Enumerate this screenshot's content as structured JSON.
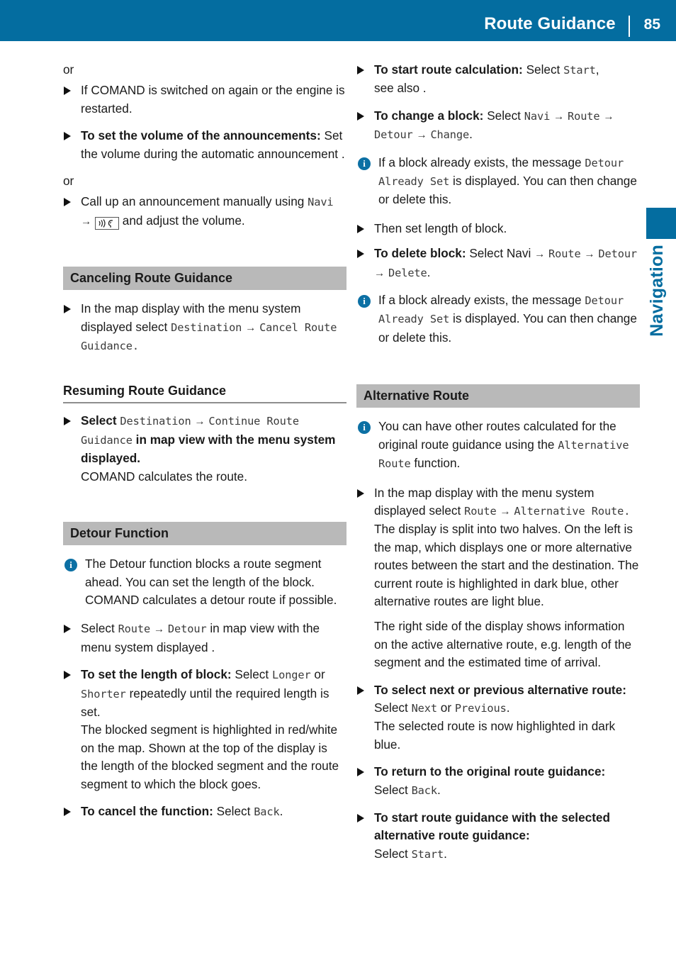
{
  "header": {
    "title": "Route Guidance",
    "page_number": "85",
    "accent_color": "#046da0"
  },
  "side_tab": {
    "label": "Navigation",
    "color": "#046da0"
  },
  "icons": {
    "bullet": "triangle-right-icon",
    "info": "info-circle-icon",
    "sound": "sound-volume-ear-icon"
  },
  "left_column": {
    "or_1": "or",
    "item_comand_restart": "If COMAND is switched on again or the engine is restarted.",
    "item_volume_bold": "To set the volume of the announcements:",
    "item_volume_rest": "Set the volume during the automatic announcement .",
    "or_2": "or",
    "item_manual_pre": "Call up an announcement manually using",
    "item_manual_menu": "Navi",
    "item_manual_arrow": "→",
    "item_manual_post": "and adjust the volume.",
    "heading_canceling": "Canceling Route Guidance",
    "item_cancel_pre": "In the map display with the menu system displayed select",
    "item_cancel_menu_1": "Destination",
    "item_cancel_arrow": "→",
    "item_cancel_menu_2": "Cancel Route Guidance",
    "item_cancel_post": ".",
    "subheading_resuming": "Resuming Route Guidance",
    "item_resume_pre": "Select",
    "item_resume_menu_1": "Destination",
    "item_resume_arrow": "→",
    "item_resume_menu_2": "Continue Route Guidance",
    "item_resume_post": "in map view with the menu system displayed.",
    "item_resume_line2": "COMAND calculates the route.",
    "heading_detour": "Detour Function",
    "note_detour": "The Detour function blocks a route segment ahead. You can set the length of the block. COMAND calculates a detour route if possible.",
    "item_select_pre": "Select",
    "item_select_menu_1": "Route",
    "item_select_arrow": "→",
    "item_select_menu_2": "Detour",
    "item_select_post": "in map view with the menu system displayed .",
    "item_length_bold": "To set the length of block:",
    "item_length_select": "Select",
    "item_length_menu_1": "Longer",
    "item_length_or": "or",
    "item_length_menu_2": "Shorter",
    "item_length_rest": "repeatedly until the required length is set.",
    "item_length_line2": "The blocked segment is highlighted in red/white on the map. Shown at the top of the display is the length of the blocked segment and the route segment to which the block goes.",
    "item_cancelfn_bold": "To cancel the function:",
    "item_cancelfn_select": "Select",
    "item_cancelfn_menu": "Back",
    "item_cancelfn_post": "."
  },
  "right_column": {
    "item_start_bold": "To start route calculation:",
    "item_start_select": "Select",
    "item_start_menu": "Start",
    "item_start_post": ",",
    "item_start_line2": "see also .",
    "item_change_bold": "To change a block:",
    "item_change_select": "Select",
    "item_change_menu_1": "Navi",
    "item_change_arrow_1": "→",
    "item_change_menu_2": "Route",
    "item_change_arrow_2": "→",
    "item_change_menu_3": "Detour",
    "item_change_arrow_3": "→",
    "item_change_menu_4": "Change",
    "item_change_post": ".",
    "note_block_exists_1_pre": "If a block already exists, the message",
    "note_block_exists_1_menu": "Detour Already Set",
    "note_block_exists_1_post": "is displayed. You can then change or delete this.",
    "item_then_set": "Then set length of block.",
    "item_delete_bold": "To delete block:",
    "item_delete_select": "Select Navi",
    "item_delete_arrow_1": "→",
    "item_delete_menu_1": "Route",
    "item_delete_arrow_2": "→",
    "item_delete_menu_2": "Detour",
    "item_delete_arrow_3": "→",
    "item_delete_menu_3": "Delete",
    "item_delete_post": ".",
    "note_block_exists_2_pre": "If a block already exists, the message",
    "note_block_exists_2_menu": "Detour Already Set",
    "note_block_exists_2_post": "is displayed. You can then change or delete this.",
    "heading_alternative": "Alternative Route",
    "note_alternative_pre": "You can have other routes calculated for the original route guidance using the",
    "note_alternative_menu": "Alternative Route",
    "note_alternative_post": "function.",
    "item_mapdisplay_pre": "In the map display with the menu system displayed select",
    "item_mapdisplay_menu_1": "Route",
    "item_mapdisplay_arrow": "→",
    "item_mapdisplay_menu_2": "Alternative Route",
    "item_mapdisplay_post": ".",
    "item_mapdisplay_line2": "The display is split into two halves. On the left is the map, which displays one or more alternative routes between the start and the destination. The current route is highlighted in dark blue, other alternative routes are light blue.",
    "item_mapdisplay_line3": "The right side of the display shows information on the active alternative route, e.g. length of the segment and the estimated time of arrival.",
    "item_nextprev_bold": "To select next or previous alternative route:",
    "item_nextprev_select": "Select",
    "item_nextprev_menu_1": "Next",
    "item_nextprev_or": "or",
    "item_nextprev_menu_2": "Previous",
    "item_nextprev_post": ".",
    "item_nextprev_line2": "The selected route is now highlighted in dark blue.",
    "item_return_bold": "To return to the original route guidance:",
    "item_return_select": "Select",
    "item_return_menu": "Back",
    "item_return_post": ".",
    "item_startguide_bold": "To start route guidance with the selected alternative route guidance:",
    "item_startguide_select": "Select",
    "item_startguide_menu": "Start",
    "item_startguide_post": "."
  }
}
